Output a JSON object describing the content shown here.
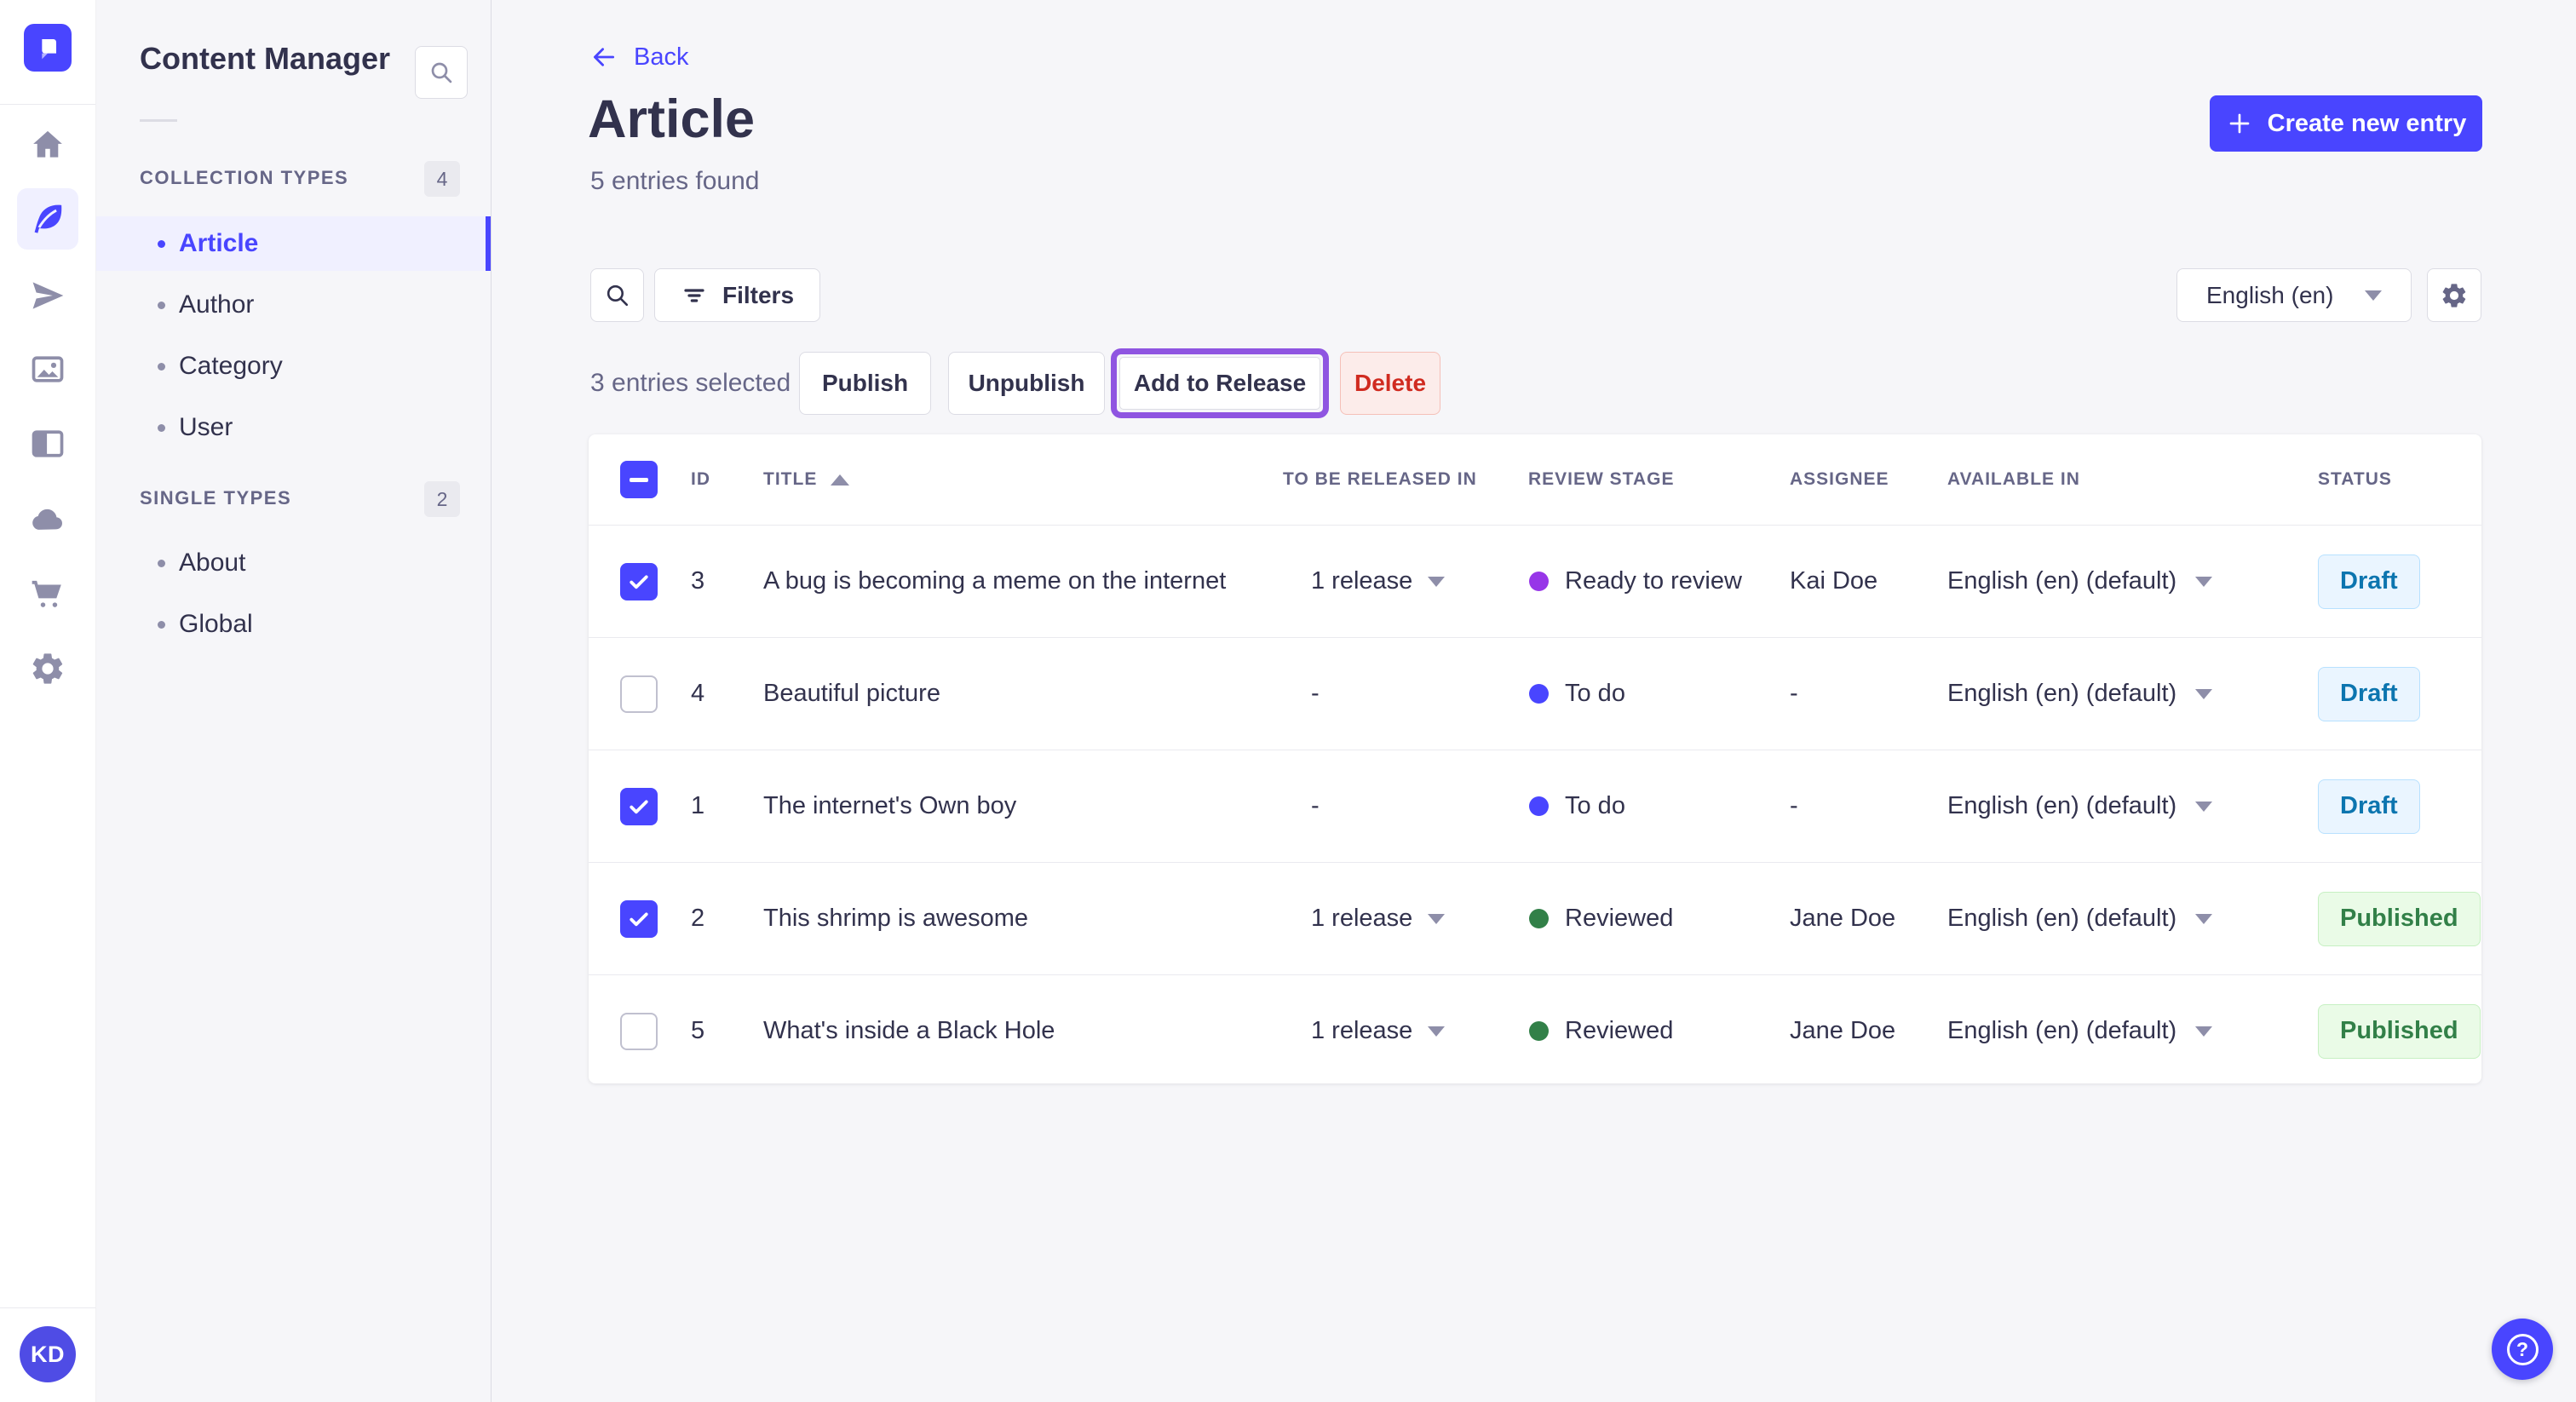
{
  "app": {
    "title": "Content Manager",
    "user_initials": "KD"
  },
  "colors": {
    "primary": "#4945FF",
    "active_item_bg": "#F0F0FF",
    "stage_ready_to_review": "#9736E8",
    "stage_to_do": "#4945FF",
    "stage_reviewed": "#328048",
    "draft_badge_text": "#0C75AF",
    "published_badge_text": "#328048",
    "delete_text": "#D02B20",
    "release_focus_ring": "#8F55E1"
  },
  "rail": {
    "icons": [
      "strapi-logo",
      "home-icon",
      "feather-icon",
      "paper-plane-icon",
      "images-icon",
      "layout-icon",
      "cloud-icon",
      "cart-icon",
      "gear-icon"
    ]
  },
  "sidebar": {
    "title": "Content Manager",
    "sections": [
      {
        "label": "COLLECTION TYPES",
        "count": "4",
        "items": [
          {
            "label": "Article"
          },
          {
            "label": "Author"
          },
          {
            "label": "Category"
          },
          {
            "label": "User"
          }
        ]
      },
      {
        "label": "SINGLE TYPES",
        "count": "2",
        "items": [
          {
            "label": "About"
          },
          {
            "label": "Global"
          }
        ]
      }
    ]
  },
  "header": {
    "back": "Back",
    "title": "Article",
    "subtitle": "5 entries found",
    "create_button": "Create new entry"
  },
  "toolbar": {
    "filters": "Filters",
    "locale": "English (en)"
  },
  "selection": {
    "summary": "3 entries selected",
    "publish": "Publish",
    "unpublish": "Unpublish",
    "add_to_release": "Add to Release",
    "delete": "Delete"
  },
  "table": {
    "headers": {
      "id": "ID",
      "title": "TITLE",
      "release": "TO BE RELEASED IN",
      "stage": "REVIEW STAGE",
      "assignee": "ASSIGNEE",
      "available": "AVAILABLE IN",
      "status": "STATUS"
    },
    "rows": [
      {
        "checked": true,
        "id": "3",
        "title": "A bug is becoming a meme on the internet",
        "release": "1 release",
        "stage": "Ready to review",
        "assignee": "Kai Doe",
        "available": "English (en) (default)",
        "status": "Draft"
      },
      {
        "checked": false,
        "id": "4",
        "title": "Beautiful picture",
        "release": "-",
        "stage": "To do",
        "assignee": "-",
        "available": "English (en) (default)",
        "status": "Draft"
      },
      {
        "checked": true,
        "id": "1",
        "title": "The internet's Own boy",
        "release": "-",
        "stage": "To do",
        "assignee": "-",
        "available": "English (en) (default)",
        "status": "Draft"
      },
      {
        "checked": true,
        "id": "2",
        "title": "This shrimp is awesome",
        "release": "1 release",
        "stage": "Reviewed",
        "assignee": "Jane Doe",
        "available": "English (en) (default)",
        "status": "Published"
      },
      {
        "checked": false,
        "id": "5",
        "title": "What's inside a Black Hole",
        "release": "1 release",
        "stage": "Reviewed",
        "assignee": "Jane Doe",
        "available": "English (en) (default)",
        "status": "Published"
      }
    ]
  }
}
